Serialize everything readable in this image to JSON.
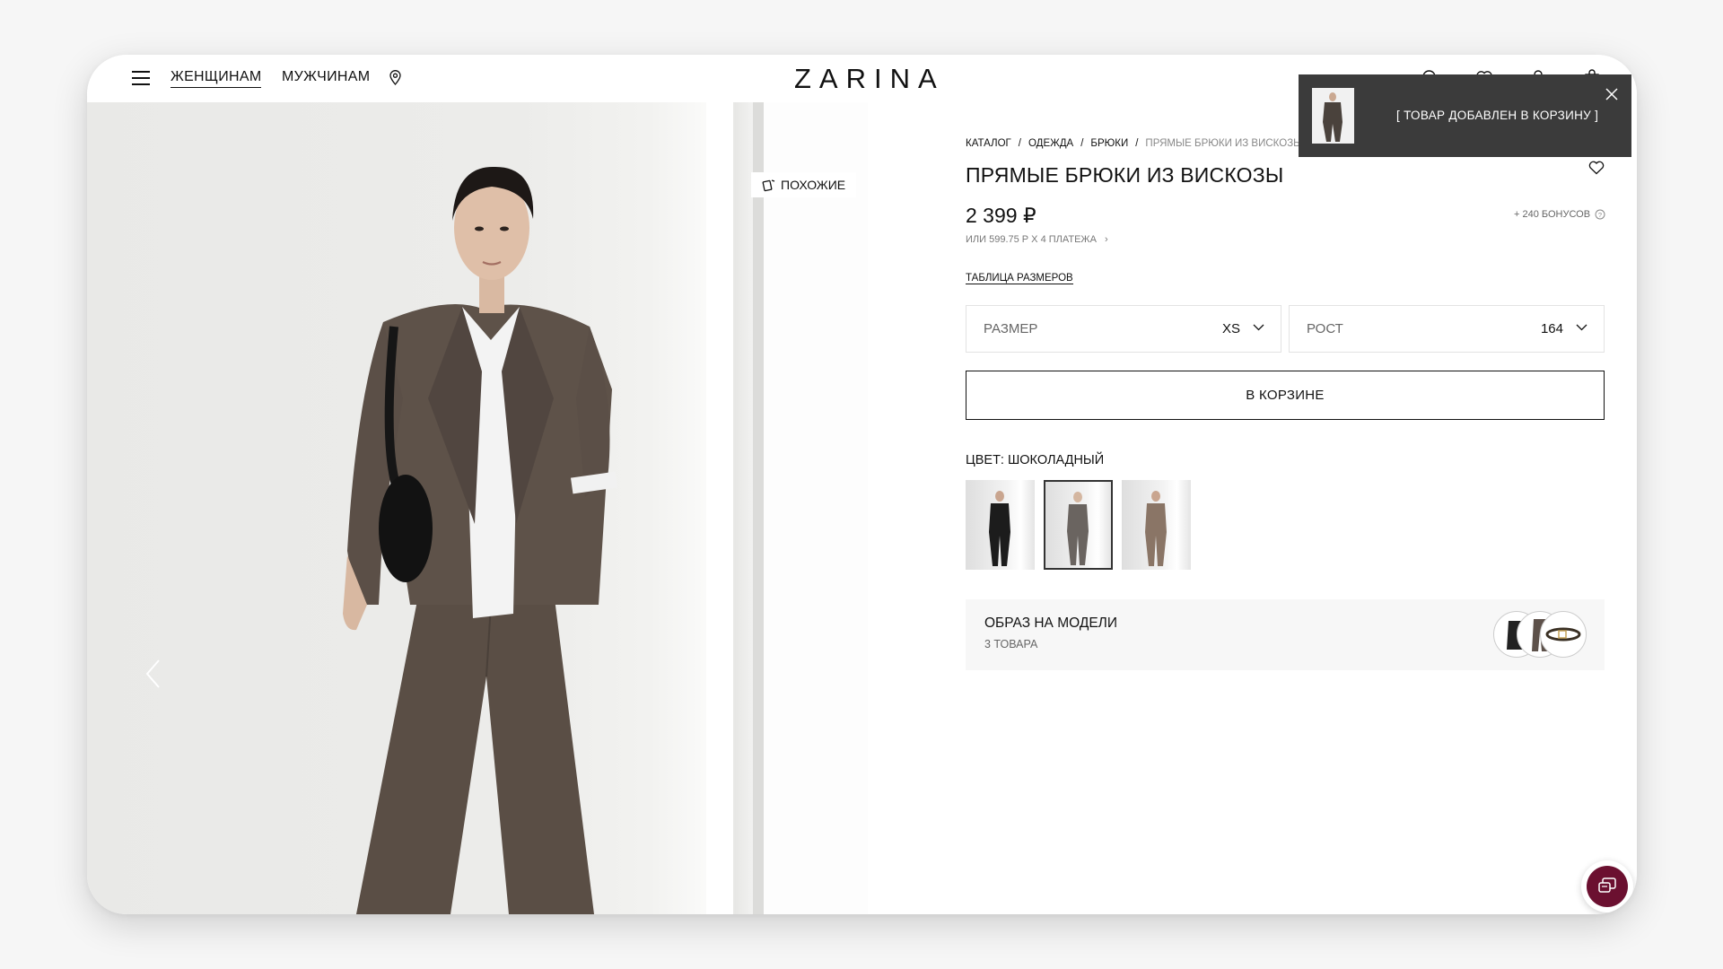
{
  "header": {
    "nav_women": "ЖЕНЩИНАМ",
    "nav_men": "МУЖЧИНАМ",
    "logo": "ZARINA",
    "icons": [
      "menu-icon",
      "location-pin-icon",
      "search-icon",
      "heart-icon",
      "user-icon",
      "bag-icon"
    ]
  },
  "gallery": {
    "similar_label": "ПОХОЖИЕ"
  },
  "breadcrumb": {
    "items": [
      "КАТАЛОГ",
      "ОДЕЖДА",
      "БРЮКИ"
    ],
    "current": "ПРЯМЫЕ БРЮКИ ИЗ ВИСКОЗЫ",
    "separator": "/"
  },
  "product": {
    "title": "ПРЯМЫЕ БРЮКИ ИЗ ВИСКОЗЫ",
    "price": "2 399 ₽",
    "installment": "ИЛИ 599.75 Р X 4 ПЛАТЕЖА",
    "bonus": "+ 240 БОНУСОВ",
    "size_table_link": "ТАБЛИЦА РАЗМЕРОВ",
    "size_label": "РАЗМЕР",
    "size_value": "XS",
    "height_label": "РОСТ",
    "height_value": "164",
    "cart_button": "В КОРЗИНЕ",
    "color_label": "ЦВЕТ: ШОКОЛАДНЫЙ",
    "color_swatches": 3,
    "selected_swatch": 2
  },
  "look": {
    "title": "ОБРАЗ НА МОДЕЛИ",
    "count": "3 ТОВАРА"
  },
  "toast": {
    "message": "[ ТОВАР ДОБАВЛЕН В КОРЗИНУ ]"
  },
  "colors": {
    "toast_bg": "#3b3b3b",
    "chat_button": "#6b1030",
    "suit": "#5b4f46"
  }
}
